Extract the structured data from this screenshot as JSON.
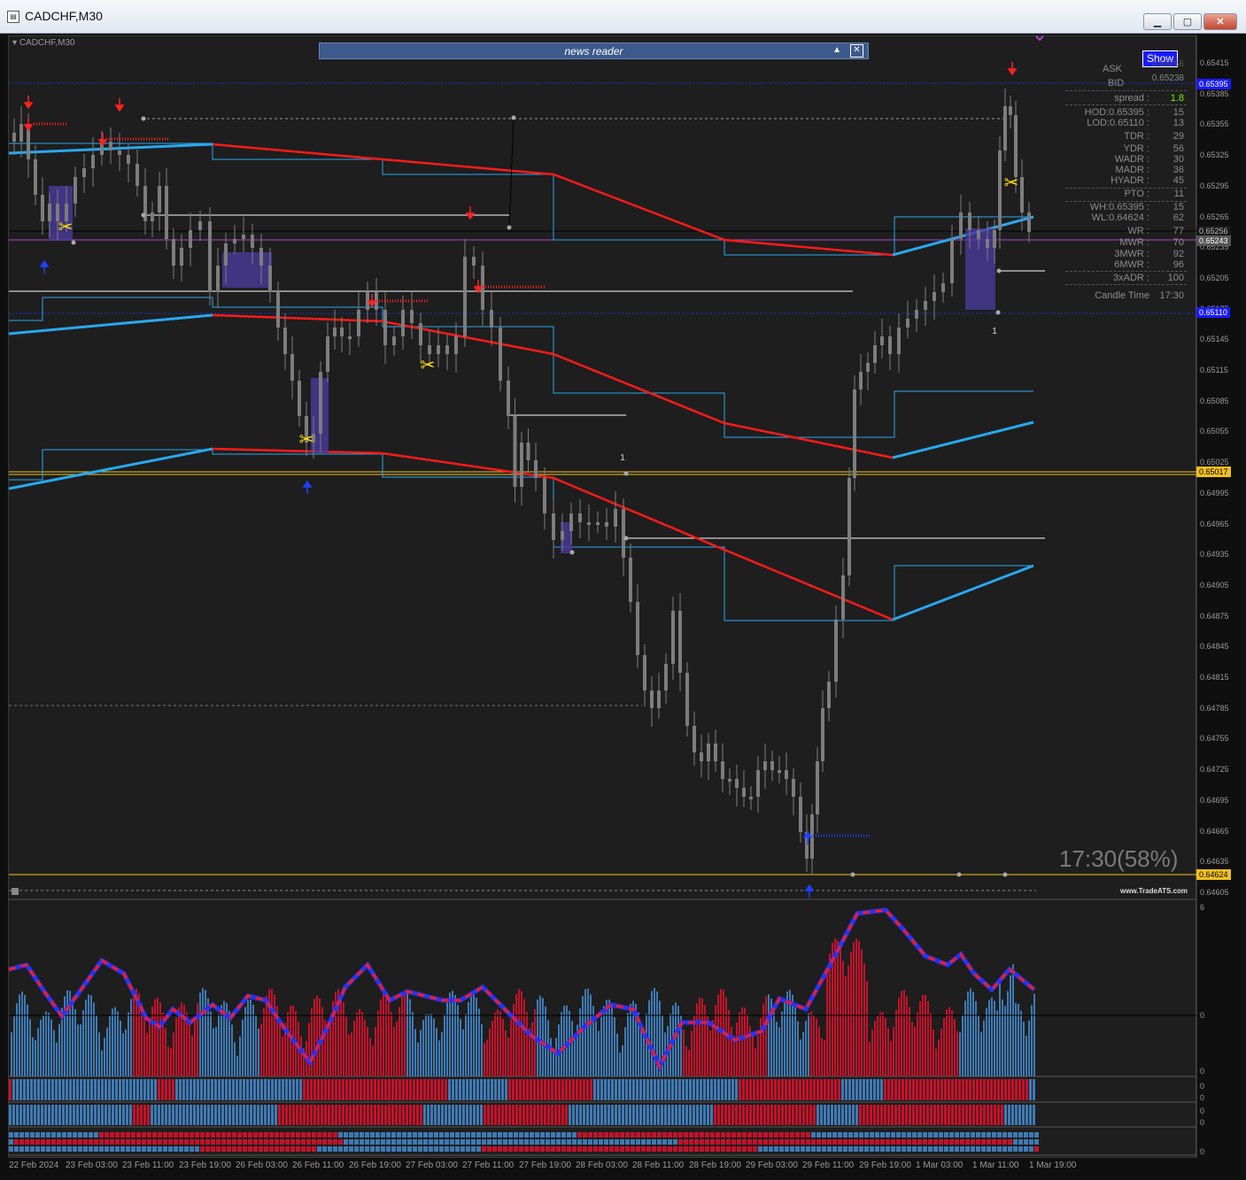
{
  "window": {
    "title": "CADCHF,M30",
    "minimize_icon": "minimize-icon",
    "maximize_icon": "maximize-icon",
    "close_icon": "close-icon"
  },
  "chart": {
    "symbol_label": "CADCHF,M30",
    "news_reader": {
      "title": "news reader"
    },
    "show_button": "Show",
    "candle_timer": "17:30(58%)",
    "watermark": "www.TradeATS.com"
  },
  "info_panel": {
    "ask_label": "ASK",
    "ask_value": "0.65256",
    "bid_label": "BID",
    "bid_value": "0.65238",
    "rows": [
      {
        "label": "spread :",
        "value": "1.8"
      },
      {
        "label": "HOD:0.65395 :",
        "value": "15"
      },
      {
        "label": "LOD:0.65110 :",
        "value": "13"
      },
      {
        "label": "TDR :",
        "value": "29"
      },
      {
        "label": "YDR :",
        "value": "56"
      },
      {
        "label": "WADR :",
        "value": "30"
      },
      {
        "label": "MADR :",
        "value": "36"
      },
      {
        "label": "HYADR :",
        "value": "45"
      },
      {
        "label": "PTO :",
        "value": "11"
      },
      {
        "label": "WH:0.65395 :",
        "value": "15"
      },
      {
        "label": "WL:0.64624 :",
        "value": "62"
      },
      {
        "label": "WR :",
        "value": "77"
      },
      {
        "label": "MWR :",
        "value": "70"
      },
      {
        "label": "3MWR :",
        "value": "92"
      },
      {
        "label": "6MWR :",
        "value": "96"
      },
      {
        "label": "3xADR :",
        "value": "100"
      },
      {
        "label": "Candle Time",
        "value": "17:30"
      }
    ]
  },
  "price_axis": {
    "labels": [
      "0.65415",
      "0.65385",
      "0.65355",
      "0.65325",
      "0.65295",
      "0.65265",
      "0.65235",
      "0.65205",
      "0.65175",
      "0.65145",
      "0.65115",
      "0.65085",
      "0.65055",
      "0.65025",
      "0.64995",
      "0.64965",
      "0.64935",
      "0.64905",
      "0.64875",
      "0.64845",
      "0.64815",
      "0.64785",
      "0.64755",
      "0.64725",
      "0.64695",
      "0.64665",
      "0.64635",
      "0.64605"
    ],
    "badges": [
      {
        "text": "0.65395",
        "bg": "#1a1aff",
        "fg": "#ffffff"
      },
      {
        "text": "0.65256",
        "bg": "#1a1a1a",
        "fg": "#bbbbbb"
      },
      {
        "text": "0.65243",
        "bg": "#555555",
        "fg": "#ffffff"
      },
      {
        "text": "0.65110",
        "bg": "#1a1aff",
        "fg": "#ffffff"
      },
      {
        "text": "0.65017",
        "bg": "#f0c020",
        "fg": "#000000"
      },
      {
        "text": "0.64624",
        "bg": "#f0c020",
        "fg": "#000000"
      }
    ]
  },
  "sub_axis": {
    "labels": [
      "6",
      "0",
      "0",
      "0",
      "0",
      "0",
      "0",
      "0"
    ]
  },
  "time_axis": {
    "labels": [
      "22 Feb 2024",
      "23 Feb 03:00",
      "23 Feb 11:00",
      "23 Feb 19:00",
      "26 Feb 03:00",
      "26 Feb 11:00",
      "26 Feb 19:00",
      "27 Feb 03:00",
      "27 Feb 11:00",
      "27 Feb 19:00",
      "28 Feb 03:00",
      "28 Feb 11:00",
      "28 Feb 19:00",
      "29 Feb 03:00",
      "29 Feb 11:00",
      "29 Feb 19:00",
      "1 Mar 03:00",
      "1 Mar 11:00",
      "1 Mar 19:00"
    ]
  },
  "markers": {
    "count_label_1": "1",
    "count_label_2": "1"
  },
  "colors": {
    "background": "#1e1e1e",
    "candle": "#7d7d7d",
    "trend_red": "#ff1a1a",
    "trend_blue": "#29a8f0",
    "histogram_blue": "#3e7ab5",
    "histogram_red": "#c4122a",
    "level_yellow": "#f0c020"
  }
}
